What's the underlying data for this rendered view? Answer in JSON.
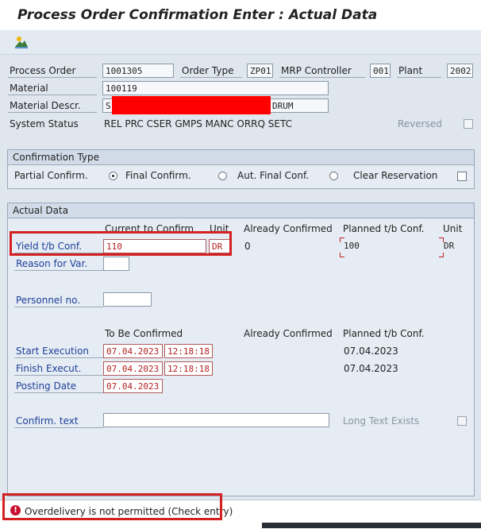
{
  "title": "Process Order Confirmation Enter : Actual Data",
  "header": {
    "process_order_label": "Process Order",
    "process_order": "1001305",
    "order_type_label": "Order Type",
    "order_type": "ZP01",
    "mrp_controller_label": "MRP Controller",
    "mrp_controller": "001",
    "plant_label": "Plant",
    "plant": "2002",
    "material_label": "Material",
    "material": "100119",
    "material_descr_label": "Material Descr.",
    "material_descr_prefix": "S",
    "material_descr_suffix": "DRUM",
    "system_status_label": "System Status",
    "system_status": "REL  PRC  CSER GMPS MANC ORRQ SETC",
    "reversed_label": "Reversed"
  },
  "confirmation_type": {
    "group_title": "Confirmation Type",
    "partial": "Partial Confirm.",
    "final": "Final Confirm.",
    "aut_final": "Aut. Final Conf.",
    "clear_reservation": "Clear Reservation"
  },
  "actual_data": {
    "group_title": "Actual Data",
    "col_current": "Current to Confirm",
    "col_unit": "Unit",
    "col_already": "Already Confirmed",
    "col_planned": "Planned t/b Conf.",
    "col_unit2": "Unit",
    "yield_label": "Yield t/b Conf.",
    "yield_value": "110",
    "yield_unit": "DR",
    "yield_already": "0",
    "yield_planned": "100",
    "planned_unit": "DR",
    "reason_label": "Reason for Var.",
    "personnel_label": "Personnel no.",
    "to_be_confirmed": "To Be Confirmed",
    "already_confirmed2": "Already Confirmed",
    "planned_conf2": "Planned t/b Conf.",
    "start_label": "Start Execution",
    "start_date": "07.04.2023",
    "start_time": "12:18:18",
    "start_planned": "07.04.2023",
    "finish_label": "Finish Execut.",
    "finish_date": "07.04.2023",
    "finish_time": "12:18:18",
    "finish_planned": "07.04.2023",
    "posting_label": "Posting Date",
    "posting_date": "07.04.2023",
    "confirm_text_label": "Confirm. text",
    "long_text_label": "Long Text Exists"
  },
  "status": {
    "message": "Overdelivery is not permitted (Check entry)",
    "icon": "error-icon"
  }
}
